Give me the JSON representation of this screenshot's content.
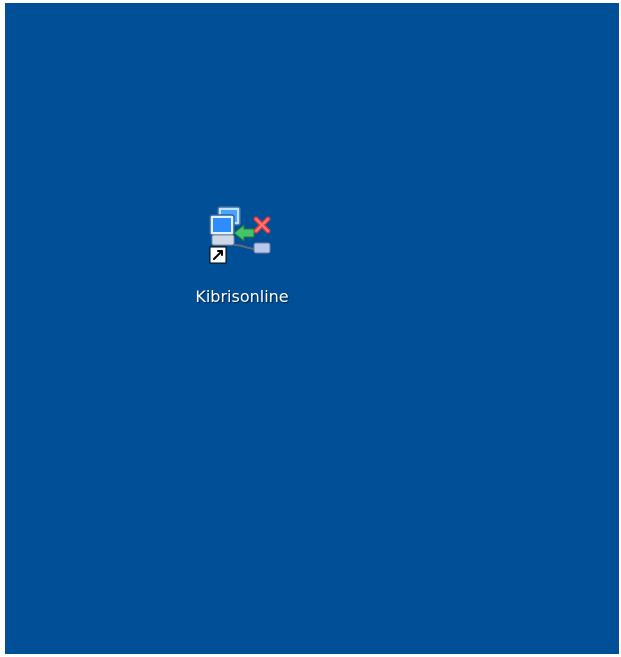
{
  "desktop": {
    "background_color": "#014f97",
    "icons": [
      {
        "label": "Kibrisonline",
        "icon": "network-connection-shortcut-icon",
        "is_shortcut": true
      }
    ]
  }
}
